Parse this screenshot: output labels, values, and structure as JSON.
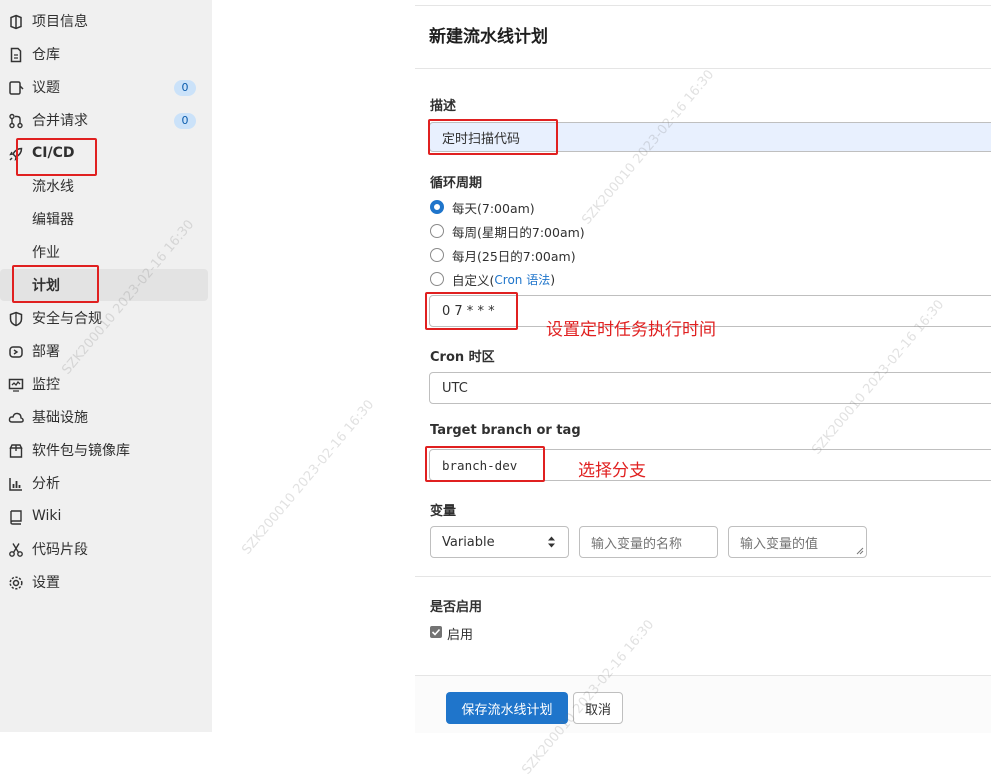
{
  "sidebar": {
    "items": [
      {
        "label": "项目信息",
        "icon": "project-icon"
      },
      {
        "label": "仓库",
        "icon": "repository-icon"
      },
      {
        "label": "议题",
        "icon": "issues-icon",
        "badge": "0"
      },
      {
        "label": "合并请求",
        "icon": "merge-request-icon",
        "badge": "0"
      },
      {
        "label": "CI/CD",
        "icon": "rocket-icon"
      },
      {
        "label": "流水线"
      },
      {
        "label": "编辑器"
      },
      {
        "label": "作业"
      },
      {
        "label": "计划",
        "active": true
      },
      {
        "label": "安全与合规",
        "icon": "shield-icon"
      },
      {
        "label": "部署",
        "icon": "deploy-icon"
      },
      {
        "label": "监控",
        "icon": "monitor-icon"
      },
      {
        "label": "基础设施",
        "icon": "cloud-icon"
      },
      {
        "label": "软件包与镜像库",
        "icon": "package-icon"
      },
      {
        "label": "分析",
        "icon": "chart-icon"
      },
      {
        "label": "Wiki",
        "icon": "book-icon"
      },
      {
        "label": "代码片段",
        "icon": "scissors-icon"
      },
      {
        "label": "设置",
        "icon": "gear-icon"
      }
    ]
  },
  "page": {
    "title": "新建流水线计划"
  },
  "form": {
    "description_label": "描述",
    "description_value": "定时扫描代码",
    "interval_label": "循环周期",
    "interval_options": [
      {
        "label": "每天(7:00am)",
        "checked": true
      },
      {
        "label": "每周(星期日的7:00am)",
        "checked": false
      },
      {
        "label": "每月(25日的7:00am)",
        "checked": false
      },
      {
        "label": "自定义(",
        "link": "Cron 语法",
        "suffix": ")",
        "checked": false
      }
    ],
    "cron_value": "0 7 * * *",
    "timezone_label": "Cron 时区",
    "timezone_value": "UTC",
    "branch_label": "Target branch or tag",
    "branch_value": "branch-dev",
    "variables_label": "变量",
    "variable_type": "Variable",
    "variable_name_placeholder": "输入变量的名称",
    "variable_value_placeholder": "输入变量的值",
    "active_label": "是否启用",
    "active_checkbox_label": "启用",
    "active_checked": true
  },
  "annotations": {
    "cron_note": "设置定时任务执行时间",
    "branch_note": "选择分支"
  },
  "buttons": {
    "save": "保存流水线计划",
    "cancel": "取消"
  },
  "watermark": "SZK200010 2023-02-16 16:30",
  "colors": {
    "accent": "#1f75cb",
    "annotation_red": "#e02020"
  }
}
